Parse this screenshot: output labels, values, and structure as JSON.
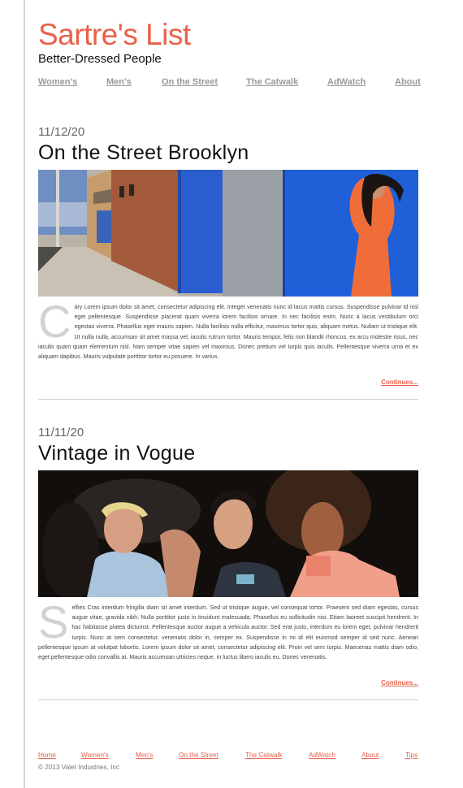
{
  "site": {
    "title": "Sartre's List",
    "tagline": "Better-Dressed People",
    "accent_color": "#e8614a"
  },
  "nav": {
    "items": [
      "Women's",
      "Men's",
      "On the Street",
      "The Catwalk",
      "AdWatch",
      "About"
    ]
  },
  "posts": [
    {
      "date": "11/12/20",
      "title": "On the Street Brooklyn",
      "image_alt": "street-photo",
      "dropcap": "C",
      "body": "ary Lorem ipsum dolor sit amet, consectetur adipiscing elit. Integer venenatis nunc id lacus mattis cursus. Suspendisse pulvinar id nisl eget pellentesque. Suspendisse placerat quam viverra lorem facilisis ornare. In nec facilisis enim. Nunc a lacus vestibulum orci egestas viverra. Phasellus eget mauris sapien. Nulla facilisis nulla efficitur, maximus tortor quis, aliquam metus. Nullam ut tristique elit. Ut nulla nulla, accumsan sit amet massa vel, iaculis rutrum tortor. Mauris tempor, felis non blandit rhoncus, ex arcu molestie risus, nec iaculis quam quam elementum nisl. Nam semper vitae sapien vel maximus. Donec pretium vel turpis quis iaculis. Pellentesque viverra urna et ex aliquam dapibus. Mauris vulputate porttitor tortor eu posuere. In varius.",
      "continue_label": "Continues..."
    },
    {
      "date": "11/11/20",
      "title": "Vintage in Vogue",
      "image_alt": "party-photo",
      "dropcap": "S",
      "body": "elfies Cras interdum fringilla diam sit amet interdum. Sed ut tristique augue, vel consequat tortor. Praesent sed diam egestas, cursus augue vitae, gravida nibh. Nulla porttitor justo in tincidunt malesuada. Phasellus eu sollicitudin nisi. Etiam laoreet suscipit hendrerit. In hac habitasse platea dictumst. Pellentesque auctor augue a vehicula auctor. Sed erat justo, interdum eu lorem eget, pulvinar hendrerit turpis. Nunc at sem consectetur, venenatis dolor in, semper ex. Suspendisse in mi id elit euismod semper id sed nunc. Aenean pellentesque ipsum at volutpat lobortis. Lorem ipsum dolor sit amet, consectetur adipiscing elit. Proin vel sem turpis. Maecenas mattis diam odio, eget pellentesque odio convallis at. Mauris accumsan ultricies neque, in luctus libero iaculis eu. Donec venenatis.",
      "continue_label": "Continues..."
    }
  ],
  "footer": {
    "links": [
      "Home",
      "Women's",
      "Men's",
      "On the Street",
      "The Catwalk",
      "AdWatch",
      "About",
      "Tips"
    ],
    "copyright": "© 2013 Valet Industries, Inc"
  }
}
